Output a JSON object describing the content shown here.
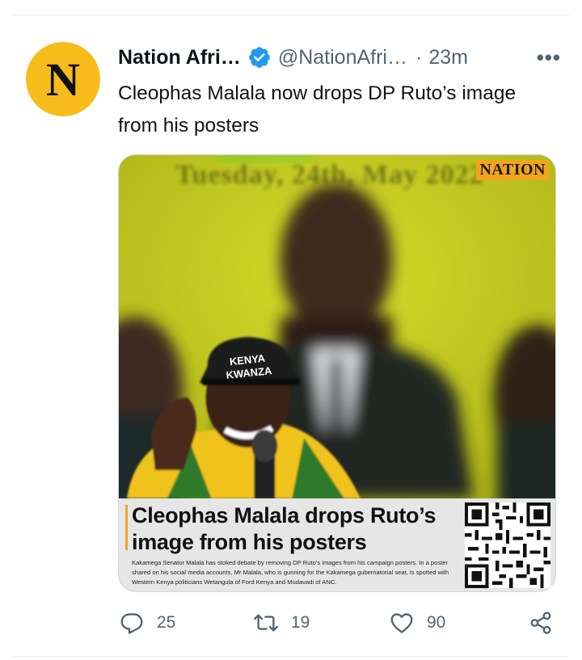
{
  "tweet": {
    "author_name": "Nation Afri…",
    "handle": "@NationAfri…",
    "separator": "·",
    "time": "23m",
    "more_label": "•••",
    "text": "Cleophas Malala now drops DP Ruto’s image from his posters",
    "avatar_letter": "N"
  },
  "media": {
    "date_overlay": "Tuesday, 24th, May 2022",
    "logo_text": "NATION",
    "cap_text_1": "KENYA",
    "cap_text_2": "KWANZA",
    "headline": "Cleophas Malala drops Ruto’s image from his posters",
    "summary": "Kakamega Senator Malala has stoked debate by removing DP Ruto’s images from his campaign posters. In a poster shared on his social media accounts, Mr Malala, who is gunning for the Kakamega gubernatorial seat, is spotted with Western Kenya politicians Wetangula of Ford Kenya and Mudavadi of ANC."
  },
  "actions": {
    "replies": "25",
    "retweets": "19",
    "likes": "90"
  },
  "colors": {
    "avatar_bg": "#f7bc1c",
    "verified": "#1d9bf0",
    "muted_text": "#536471",
    "photo_bg": "#c6cc1e",
    "nation_orange": "#f2a51b"
  },
  "icons": [
    "verified-badge-icon",
    "more-icon",
    "reply-icon",
    "retweet-icon",
    "like-icon",
    "share-icon"
  ]
}
